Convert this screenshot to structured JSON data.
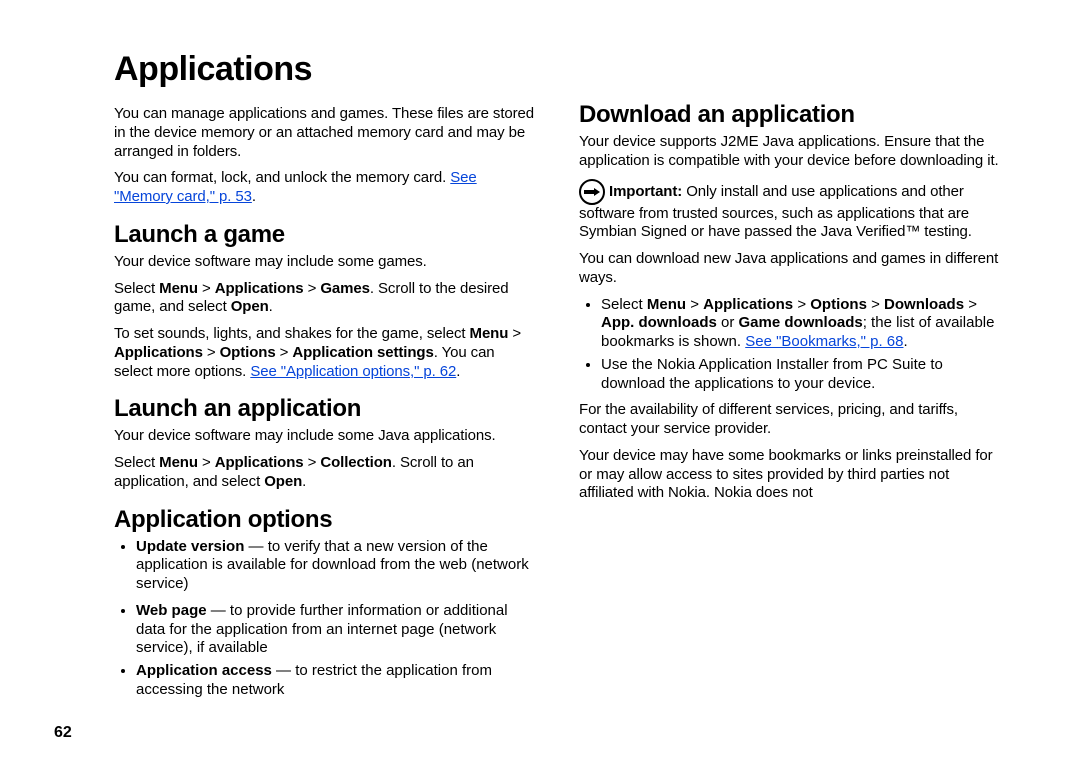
{
  "pagenum": "62",
  "h1": "Applications",
  "intro_p1": "You can manage applications and games. These files are stored in the device memory or an attached memory card and may be arranged in folders.",
  "intro_p2_a": "You can format, lock, and unlock the memory card. ",
  "intro_p2_link": "See \"Memory card,\" p. 53",
  "intro_p2_b": ".",
  "launch_game_h": "Launch a game",
  "lg_p1": "Your device software may include some games.",
  "lg_p2_a": "Select ",
  "lg_p2_b1": "Menu",
  "lg_p2_sep": " > ",
  "lg_p2_b2": "Applications",
  "lg_p2_b3": "Games",
  "lg_p2_c": ". Scroll to the desired game, and select ",
  "lg_p2_b4": "Open",
  "lg_p2_d": ".",
  "lg_p3_a": "To set sounds, lights, and shakes for the game, select ",
  "lg_p3_b1": "Menu",
  "lg_p3_b2": "Applications",
  "lg_p3_b3": "Options",
  "lg_p3_b4": "Application settings",
  "lg_p3_c": ". You can select more options. ",
  "lg_p3_link": "See \"Application options,\" p. 62",
  "lg_p3_d": ".",
  "launch_app_h": "Launch an application",
  "la_p1": "Your device software may include some Java applications.",
  "la_p2_a": "Select ",
  "la_p2_b1": "Menu",
  "la_p2_b2": "Applications",
  "la_p2_b3": "Collection",
  "la_p2_c": ". Scroll to an application, and select ",
  "la_p2_b4": "Open",
  "la_p2_d": ".",
  "app_opt_h": "Application options",
  "ao_li1_b": "Update version",
  "ao_li1_t": " — to verify that a new version of the application is available for download from the web (network service)",
  "ao_li2_b": "Web page",
  "ao_li2_t": " — to provide further information or additional data for the application from an internet page (network service), if available",
  "ao_li3_b": "Application access",
  "ao_li3_t": " — to restrict the application from accessing the network",
  "download_h": "Download an application",
  "dl_p1": "Your device supports J2ME Java applications. Ensure that the application is compatible with your device before downloading it.",
  "dl_imp_b": "Important:",
  "dl_imp_t": "  Only install and use applications and other software from trusted sources, such as applications that are Symbian Signed or have passed the Java Verified™ testing.",
  "dl_p2": "You can download new Java applications and games in different ways.",
  "dl_li1_a": "Select ",
  "dl_li1_b1": "Menu",
  "dl_li1_b2": "Applications",
  "dl_li1_b3": "Options",
  "dl_li1_b4": "Downloads",
  "dl_li1_b5": "App. downloads",
  "dl_li1_or": " or ",
  "dl_li1_b6": "Game downloads",
  "dl_li1_c": "; the list of available bookmarks is shown. ",
  "dl_li1_link": "See \"Bookmarks,\" p. 68",
  "dl_li1_d": ".",
  "dl_li2": "Use the Nokia Application Installer from PC Suite to download the applications to your device.",
  "dl_p3": "For the availability of different services, pricing, and tariffs, contact your service provider.",
  "dl_p4": "Your device may have some bookmarks or links preinstalled for or may allow access to sites provided by third parties not affiliated with Nokia. Nokia does not"
}
